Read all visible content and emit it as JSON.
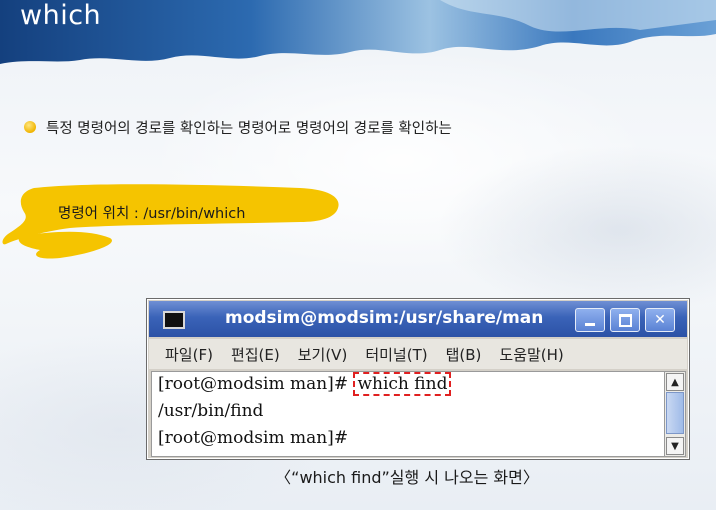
{
  "slide": {
    "title": "which",
    "bullet": "특정 명령어의 경로를 확인하는 명령어로 명령어의 경로를 확인하는",
    "highlight_text": "명령어 위치 : /usr/bin/which",
    "caption": "〈“which find”실행 시 나오는 화면〉"
  },
  "terminal": {
    "title": "modsim@modsim:/usr/share/man",
    "menu": [
      "파일(F)",
      "편집(E)",
      "보기(V)",
      "터미널(T)",
      "탭(B)",
      "도움말(H)"
    ],
    "prompt1": "[root@modsim man]# ",
    "command": "which find",
    "output": "/usr/bin/find",
    "prompt2": "[root@modsim man]#"
  },
  "colors": {
    "title_bar": "#3a63b8",
    "highlight": "#f5c400",
    "command_box": "#e02020"
  },
  "icons": {
    "bullet": "bullet-dot-icon",
    "terminal": "terminal-icon",
    "minimize": "minimize-icon",
    "maximize": "maximize-icon",
    "close": "close-icon",
    "scroll_up": "arrow-up-icon",
    "scroll_down": "arrow-down-icon"
  }
}
